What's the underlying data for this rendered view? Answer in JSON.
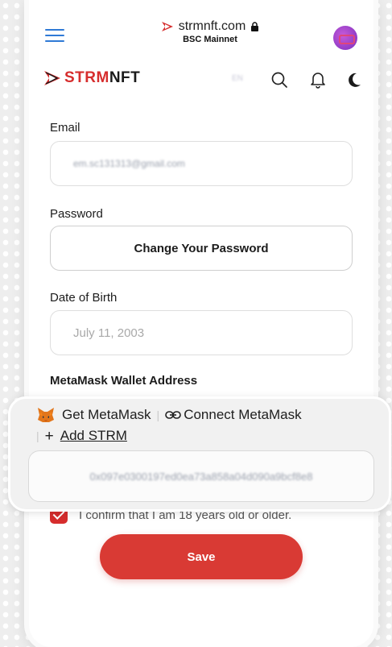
{
  "browser": {
    "domain": "strmnft.com",
    "network": "BSC Mainnet"
  },
  "header": {
    "brand_red": "STRM",
    "brand_dark": "NFT",
    "language": "EN"
  },
  "form": {
    "email_label": "Email",
    "email_value": "em.sc131313@gmail.com",
    "password_label": "Password",
    "change_password_label": "Change Your Password",
    "dob_label": "Date of Birth",
    "dob_value": "July 11, 2003",
    "wallet_label": "MetaMask Wallet Address",
    "get_metamask": "Get MetaMask",
    "connect_metamask": "Connect MetaMask",
    "add_strm": "Add STRM",
    "wallet_value": "0x097e0300197ed0ea73a858a04d090a9bcf8e8",
    "confirm_label": "I confirm that I am 18 years old or older.",
    "save_label": "Save"
  },
  "colors": {
    "accent": "#d62d2d",
    "menu": "#2f7ad6"
  }
}
